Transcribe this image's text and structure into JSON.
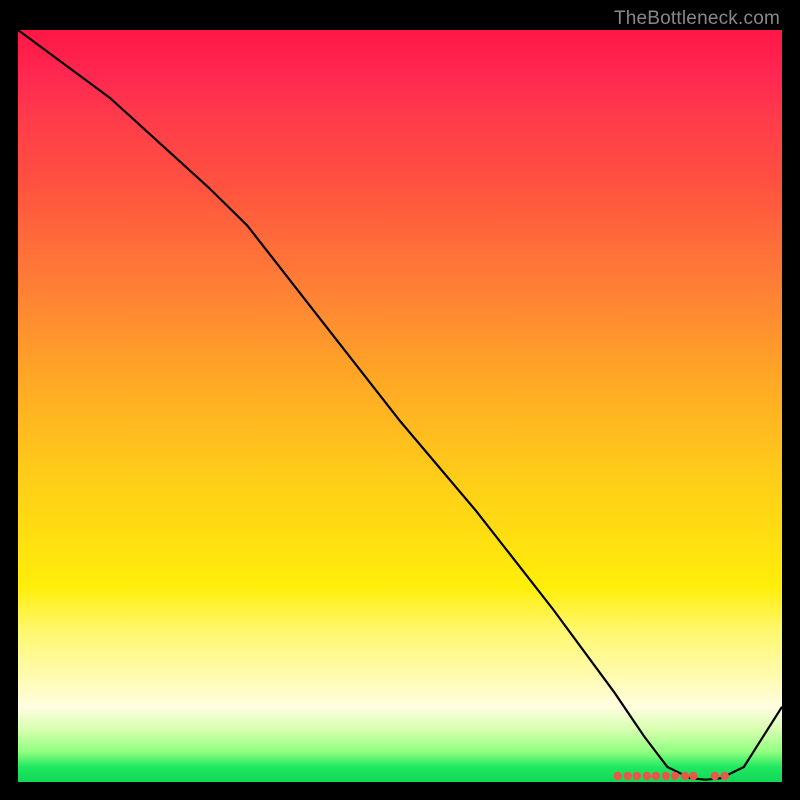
{
  "watermark": "TheBottleneck.com",
  "chart_data": {
    "type": "line",
    "title": "",
    "xlabel": "",
    "ylabel": "",
    "xlim": [
      0,
      100
    ],
    "ylim": [
      0,
      100
    ],
    "series": [
      {
        "name": "curve",
        "x": [
          0,
          12,
          25,
          30,
          40,
          50,
          60,
          70,
          78,
          82,
          85,
          88,
          90,
          92,
          95,
          100
        ],
        "values": [
          100,
          91,
          79,
          74,
          61,
          48,
          36,
          23,
          12,
          6,
          2,
          0.5,
          0.3,
          0.5,
          2,
          10
        ]
      }
    ],
    "markers": {
      "x_positions": [
        78.5,
        79.8,
        81.0,
        82.3,
        83.5,
        84.8,
        86.0,
        87.3,
        88.4,
        91.2,
        92.5
      ],
      "y": 0.8,
      "color": "#e8584a"
    },
    "gradient_colors": {
      "top": "#ff1744",
      "mid": "#ffd010",
      "bottom": "#20e860"
    }
  }
}
